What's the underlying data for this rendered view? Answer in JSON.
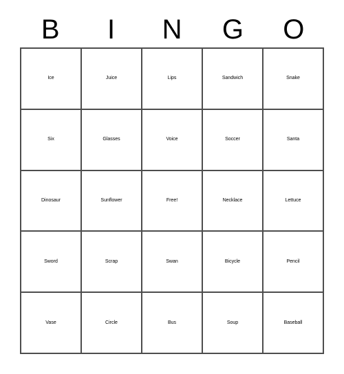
{
  "card": {
    "title": "BINGO",
    "header_letters": [
      "B",
      "I",
      "N",
      "G",
      "O"
    ],
    "border_color": "#4d4d4d",
    "background_color": "#ffffff",
    "text_color": "#000000",
    "columns": 5,
    "rows": 5,
    "free_space": {
      "row": 2,
      "column": 2,
      "label": "Free!"
    },
    "grid": [
      [
        {
          "label": "Ice",
          "size": "fs-xl"
        },
        {
          "label": "Juice",
          "size": "fs-lg"
        },
        {
          "label": "Lips",
          "size": "fs-xl"
        },
        {
          "label": "Sandwich",
          "size": "fs-xs"
        },
        {
          "label": "Snake",
          "size": "fs-md"
        }
      ],
      [
        {
          "label": "Six",
          "size": "fs-xl"
        },
        {
          "label": "Glasses",
          "size": "fs-sm"
        },
        {
          "label": "Voice",
          "size": "fs-lg"
        },
        {
          "label": "Soccer",
          "size": "fs-md"
        },
        {
          "label": "Santa",
          "size": "fs-md"
        }
      ],
      [
        {
          "label": "Dinosaur",
          "size": "fs-xs"
        },
        {
          "label": "Sunflower",
          "size": "fs-xxs"
        },
        {
          "label": "Free!",
          "size": "fs-lg"
        },
        {
          "label": "Necklace",
          "size": "fs-xs"
        },
        {
          "label": "Lettuce",
          "size": "fs-sm"
        }
      ],
      [
        {
          "label": "Sword",
          "size": "fs-md"
        },
        {
          "label": "Scrap",
          "size": "fs-md"
        },
        {
          "label": "Swan",
          "size": "fs-md"
        },
        {
          "label": "Bicycle",
          "size": "fs-sm"
        },
        {
          "label": "Pencil",
          "size": "fs-md"
        }
      ],
      [
        {
          "label": "Vase",
          "size": "fs-lg"
        },
        {
          "label": "Circle",
          "size": "fs-md"
        },
        {
          "label": "Bus",
          "size": "fs-xl"
        },
        {
          "label": "Soup",
          "size": "fs-lg"
        },
        {
          "label": "Baseball",
          "size": "fs-xs"
        }
      ]
    ]
  }
}
